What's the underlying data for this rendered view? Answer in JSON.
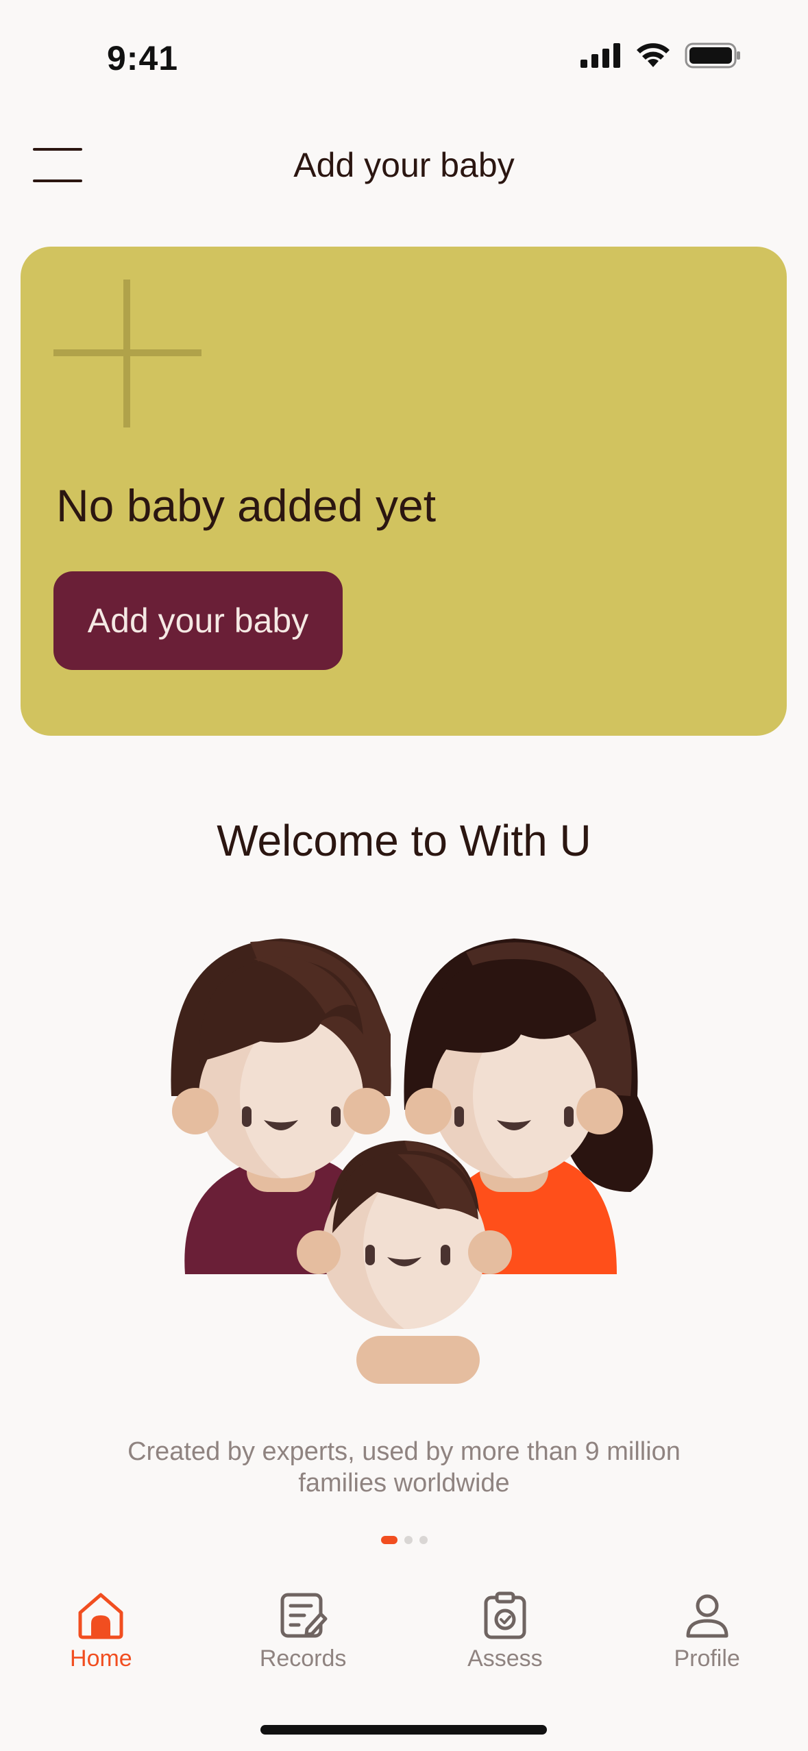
{
  "status_bar": {
    "time": "9:41"
  },
  "header": {
    "title": "Add your baby"
  },
  "card": {
    "title": "No baby added yet",
    "button_label": "Add your baby"
  },
  "welcome": {
    "title": "Welcome to With U",
    "subtitle": "Created by experts, used by more than 9 million families worldwide"
  },
  "carousel": {
    "pages": 3,
    "active_index": 0
  },
  "tabs": [
    {
      "label": "Home",
      "icon": "home-icon",
      "active": true
    },
    {
      "label": "Records",
      "icon": "records-icon",
      "active": false
    },
    {
      "label": "Assess",
      "icon": "assess-icon",
      "active": false
    },
    {
      "label": "Profile",
      "icon": "profile-icon",
      "active": false
    }
  ],
  "colors": {
    "accent": "#F14E20",
    "card_bg": "#D1C35F",
    "button_bg": "#6A1F37",
    "text_dark": "#2B1611",
    "text_muted": "#8F8380"
  }
}
